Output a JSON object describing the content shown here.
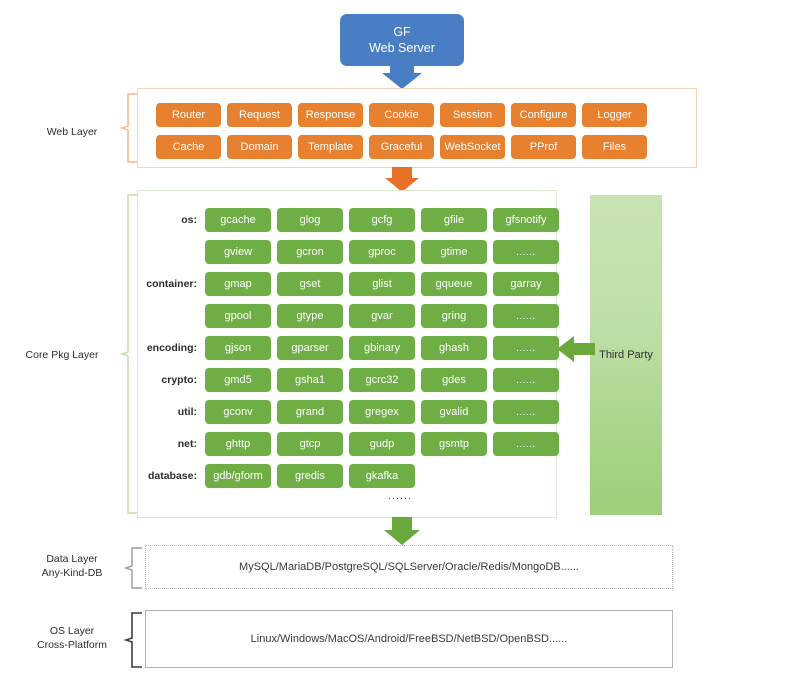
{
  "diagram": {
    "title_lines": [
      "GF",
      "Web Server"
    ]
  },
  "colors": {
    "server_blue": "#4a7ec4",
    "web_orange": "#e8812f",
    "core_green": "#6fae44",
    "third_party_green": "#bfdfa7",
    "arrow_orange": "#e8712a",
    "arrow_green": "#6aa83b"
  },
  "layers": {
    "web": {
      "label_lines": [
        "Web Layer"
      ],
      "rows": [
        [
          "Router",
          "Request",
          "Response",
          "Cookie",
          "Session",
          "Configure",
          "Logger"
        ],
        [
          "Cache",
          "Domain",
          "Template",
          "Graceful",
          "WebSocket",
          "PProf",
          "Files"
        ]
      ]
    },
    "core": {
      "label_lines": [
        "Core Pkg Layer"
      ],
      "groups": [
        {
          "name": "os:",
          "rows": [
            [
              "gcache",
              "glog",
              "gcfg",
              "gfile",
              "gfsnotify"
            ],
            [
              "gview",
              "gcron",
              "gproc",
              "gtime",
              "......"
            ]
          ]
        },
        {
          "name": "container:",
          "rows": [
            [
              "gmap",
              "gset",
              "glist",
              "gqueue",
              "garray"
            ],
            [
              "gpool",
              "gtype",
              "gvar",
              "gring",
              "......"
            ]
          ]
        },
        {
          "name": "encoding:",
          "rows": [
            [
              "gjson",
              "gparser",
              "gbinary",
              "ghash",
              "......"
            ]
          ]
        },
        {
          "name": "crypto:",
          "rows": [
            [
              "gmd5",
              "gsha1",
              "gcrc32",
              "gdes",
              "......"
            ]
          ]
        },
        {
          "name": "util:",
          "rows": [
            [
              "gconv",
              "grand",
              "gregex",
              "gvalid",
              "......"
            ]
          ]
        },
        {
          "name": "net:",
          "rows": [
            [
              "ghttp",
              "gtcp",
              "gudp",
              "gsmtp",
              "......"
            ]
          ]
        },
        {
          "name": "database:",
          "rows": [
            [
              "gdb/gform",
              "gredis",
              "gkafka"
            ]
          ]
        }
      ],
      "footer_ellipsis": "......"
    },
    "third_party": {
      "label": "Third Party"
    },
    "data": {
      "label_lines": [
        "Data Layer",
        "Any-Kind-DB"
      ],
      "content": "MySQL/MariaDB/PostgreSQL/SQLServer/Oracle/Redis/MongoDB......"
    },
    "os": {
      "label_lines": [
        "OS Layer",
        "Cross-Platform"
      ],
      "content": "Linux/Windows/MacOS/Android/FreeBSD/NetBSD/OpenBSD......"
    }
  }
}
